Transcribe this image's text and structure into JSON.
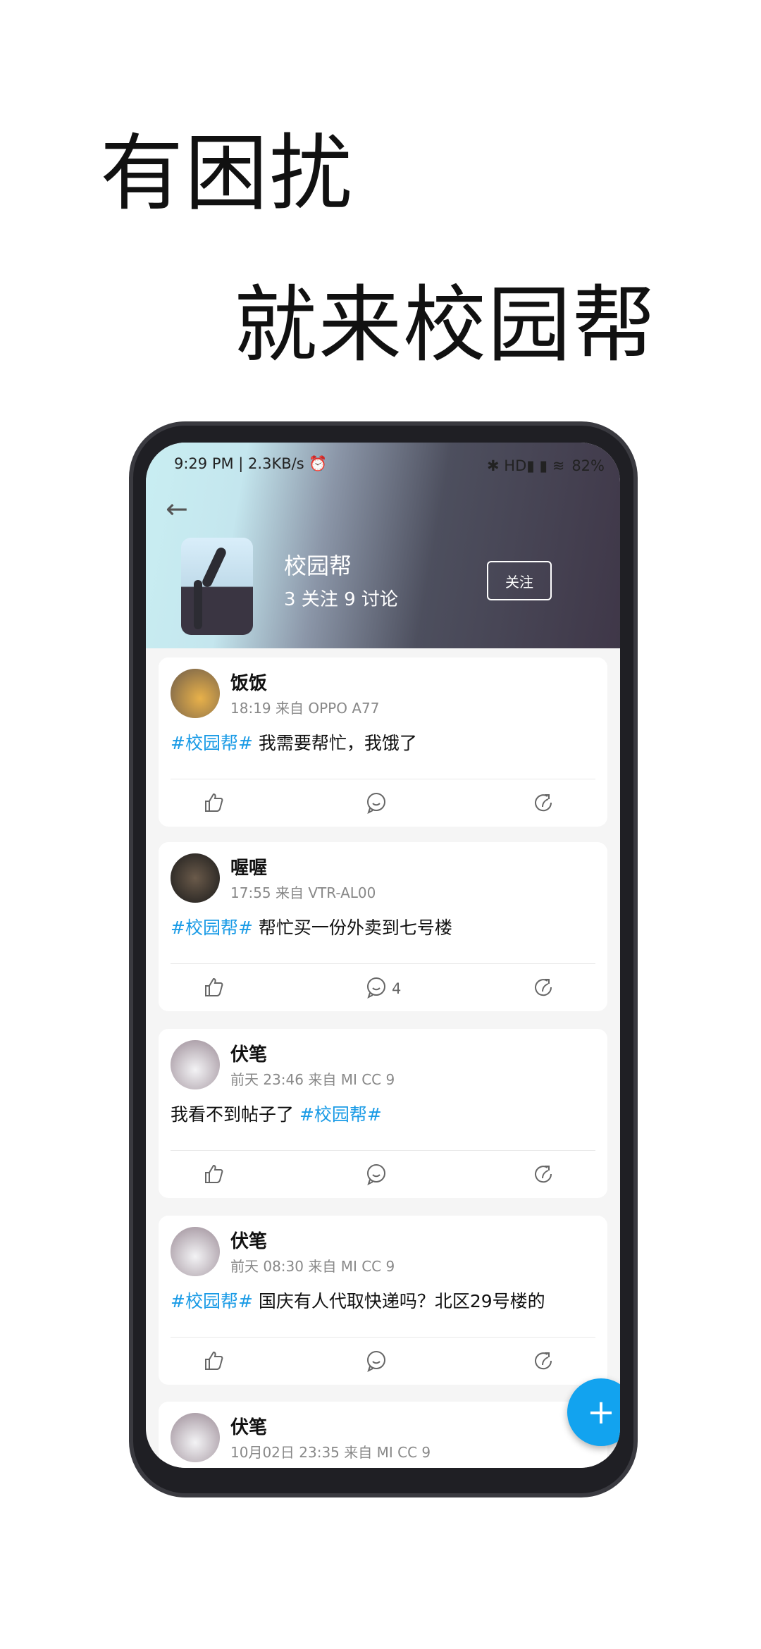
{
  "slogan": {
    "line1": "有困扰",
    "line2": "就来校园帮"
  },
  "status": {
    "left": "9:29 PM | 2.3KB/s ⏰",
    "right": "✱ HD▮ ▮ ≋",
    "battery": "82%"
  },
  "header": {
    "back": "←",
    "title": "校园帮",
    "stats": "3 关注  9 讨论",
    "follow": "关注"
  },
  "posts": [
    {
      "name": "饭饭",
      "meta": "18:19 来自 OPPO A77",
      "tag": "#校园帮#",
      "text": " 我需要帮忙，我饿了",
      "tag_first": true,
      "comments": ""
    },
    {
      "name": "喔喔",
      "meta": "17:55 来自 VTR-AL00",
      "tag": "#校园帮#",
      "text": " 帮忙买一份外卖到七号楼",
      "tag_first": true,
      "comments": "4"
    },
    {
      "name": "伏笔",
      "meta": "前天 23:46 来自 MI CC 9",
      "tag": "#校园帮#",
      "text": "我看不到帖子了 ",
      "tag_first": false,
      "comments": ""
    },
    {
      "name": "伏笔",
      "meta": "前天 08:30 来自 MI CC 9",
      "tag": "#校园帮#",
      "text": " 国庆有人代取快递吗？北区29号楼的",
      "tag_first": true,
      "comments": ""
    },
    {
      "name": "伏笔",
      "meta": "10月02日 23:35 来自 MI CC 9",
      "tag": "",
      "text": "",
      "tag_first": true,
      "comments": ""
    }
  ],
  "fab": "+",
  "colors": {
    "accent": "#12a3ef",
    "tag": "#1a9be6"
  }
}
